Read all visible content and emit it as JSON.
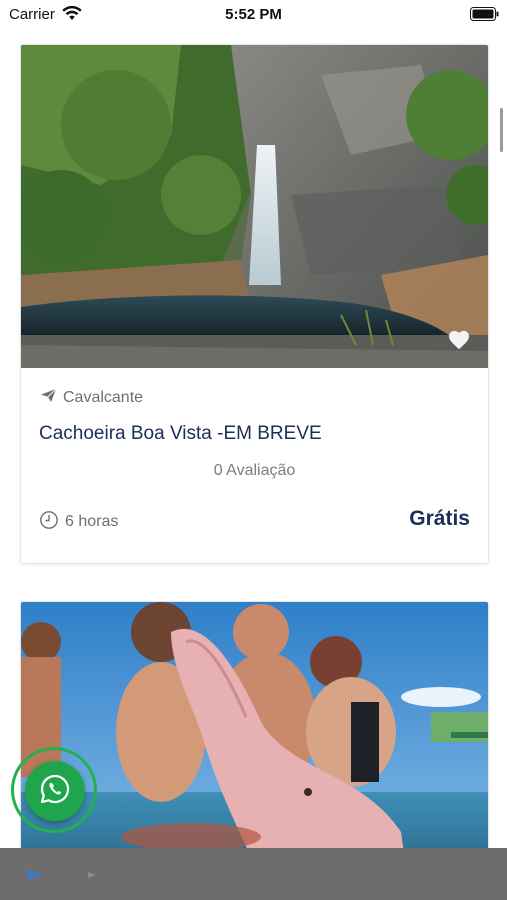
{
  "status_bar": {
    "carrier": "Carrier",
    "time": "5:52 PM"
  },
  "cards": [
    {
      "location": "Cavalcante",
      "title": "Cachoeira Boa Vista -EM BREVE",
      "reviews": "0 Avaliação",
      "duration": "6 horas",
      "price": "Grátis",
      "photo_icon": "waterfall-photo",
      "favorite_icon": "heart-icon"
    },
    {
      "photo_icon": "pink-dolphin-photo"
    }
  ],
  "colors": {
    "title": "#1d2d5a",
    "muted_text": "#6b6f78",
    "whatsapp_green": "#1fa64c",
    "bottom_bar": "#6d6d6d",
    "back_arrow": "#2f7de1"
  },
  "icons": {
    "location": "paper-plane-icon",
    "duration": "clock-icon",
    "whatsapp": "whatsapp-icon",
    "nav_back": "back-arrow-icon",
    "nav_forward": "forward-arrow-icon"
  }
}
